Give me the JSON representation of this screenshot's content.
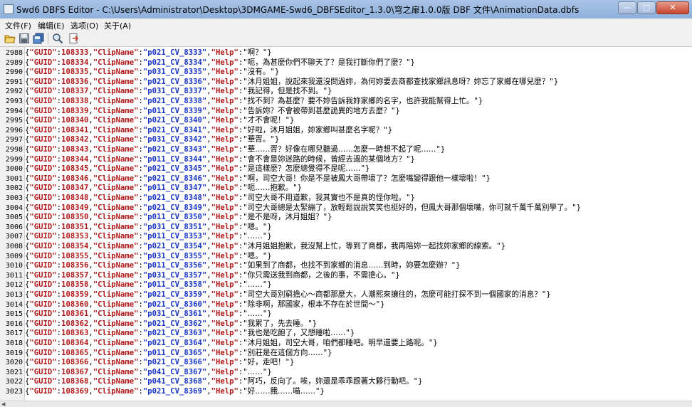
{
  "window": {
    "title": "Swd6 DBFS Editor - C:\\Users\\Administrator\\Desktop\\3DMGAME-Swd6_DBFSEditor_1.3.0\\穹之扉1.0.0版 DBF 文件\\AnimationData.dbfs",
    "min_label": "—",
    "max_label": "□",
    "close_label": "✕"
  },
  "menu": [
    {
      "label": "文件(F)"
    },
    {
      "label": "编辑(E)"
    },
    {
      "label": "选项(O)"
    },
    {
      "label": "关于(A)"
    }
  ],
  "toolbar_icons": [
    "open-folder-icon",
    "save-icon",
    "save-all-icon",
    "search-icon",
    "export-icon"
  ],
  "colors": {
    "key": "#b11a1a",
    "string_value": "#1a37c5",
    "number_value": "#b11a1a"
  },
  "rows": [
    {
      "n": "2988",
      "guid": "108333",
      "clip": "p021_CV_8333",
      "help": "啊？"
    },
    {
      "n": "2989",
      "guid": "108334",
      "clip": "p021_CV_8334",
      "help": "呃，為甚麼你們不聊天了？是我打斷你們了麼？"
    },
    {
      "n": "2990",
      "guid": "108335",
      "clip": "p031_CV_8335",
      "help": "沒有。"
    },
    {
      "n": "2991",
      "guid": "108336",
      "clip": "p021_CV_8336",
      "help": "沐月姐姐，說起來我還沒問過妳，為何妳要去商都查找家鄉訊息呀？妳忘了家鄉在哪兒麼？"
    },
    {
      "n": "2992",
      "guid": "108337",
      "clip": "p031_CV_8337",
      "help": "我記得，但是找不到。"
    },
    {
      "n": "2993",
      "guid": "108338",
      "clip": "p021_CV_8338",
      "help": "找不到？為甚麼？要不妳告訴我妳家鄉的名字，也許我能幫得上忙。"
    },
    {
      "n": "2994",
      "guid": "108339",
      "clip": "p011_CV_8339",
      "help": "告訴妳？不會被帶到甚麼詭異的地方去麼？"
    },
    {
      "n": "2995",
      "guid": "108340",
      "clip": "p021_CV_8340",
      "help": "才不會呢！"
    },
    {
      "n": "2996",
      "guid": "108341",
      "clip": "p021_CV_8341",
      "help": "好啦，沐月姐姐，妳家鄉叫甚麼名字呢？"
    },
    {
      "n": "2997",
      "guid": "108342",
      "clip": "p031_CV_8342",
      "help": "華胥。"
    },
    {
      "n": "2998",
      "guid": "108343",
      "clip": "p021_CV_8343",
      "help": "華……胥？好像在哪兒聽過……怎麼一時想不起了呢……"
    },
    {
      "n": "2999",
      "guid": "108344",
      "clip": "p011_CV_8344",
      "help": "會不會是妳迷路的時候，曾經去過的某個地方？"
    },
    {
      "n": "3000",
      "guid": "108345",
      "clip": "p021_CV_8345",
      "help": "是這樣麼？怎麼總覺得不是呢……"
    },
    {
      "n": "3001",
      "guid": "108346",
      "clip": "p021_CV_8346",
      "help": "啊，司空大哥！你是不是被鳳大哥帶壞了？怎麼嘴變得跟他一樣壞啦！"
    },
    {
      "n": "3002",
      "guid": "108347",
      "clip": "p011_CV_8347",
      "help": "呃……抱歉。"
    },
    {
      "n": "3003",
      "guid": "108348",
      "clip": "p021_CV_8348",
      "help": "司空大哥不用道歉，我其實也不是真的怪你啦。"
    },
    {
      "n": "3004",
      "guid": "108349",
      "clip": "p021_CV_8349",
      "help": "司空大哥總是太緊繃了，放輕鬆說說笑笑也挺好的，但鳳大哥那個壞嘴，你可就千萬千萬別學了。"
    },
    {
      "n": "3005",
      "guid": "108350",
      "clip": "p011_CV_8350",
      "help": "是不是呀，沐月姐姐？"
    },
    {
      "n": "3006",
      "guid": "108351",
      "clip": "p031_CV_8351",
      "help": "嗯。"
    },
    {
      "n": "3007",
      "guid": "108353",
      "clip": "p011_CV_8353",
      "help": "……"
    },
    {
      "n": "3008",
      "guid": "108354",
      "clip": "p021_CV_8354",
      "help": "沐月姐姐抱歉，我沒幫上忙，等到了商都，我再陪妳一起找妳家鄉的線索。"
    },
    {
      "n": "3009",
      "guid": "108355",
      "clip": "p031_CV_8355",
      "help": "嗯。"
    },
    {
      "n": "3010",
      "guid": "108356",
      "clip": "p011_CV_8356",
      "help": "如果到了商都，也找不到家鄉的消息……到時，妳要怎麼辦？"
    },
    {
      "n": "3011",
      "guid": "108357",
      "clip": "p031_CV_8357",
      "help": "你只需送我到商都，之後的事，不需擔心。"
    },
    {
      "n": "3012",
      "guid": "108358",
      "clip": "p011_CV_8358",
      "help": "……"
    },
    {
      "n": "3013",
      "guid": "108359",
      "clip": "p021_CV_8359",
      "help": "司空大哥別窮擔心～商都那麼大，人潮熙來攘往的，怎麼可能打探不到一個國家的消息？"
    },
    {
      "n": "3014",
      "guid": "108360",
      "clip": "p021_CV_8360",
      "help": "除非啊，那國家，根本不存在於世間～"
    },
    {
      "n": "3015",
      "guid": "108361",
      "clip": "p031_CV_8361",
      "help": "……"
    },
    {
      "n": "3016",
      "guid": "108362",
      "clip": "p021_CV_8362",
      "help": "我累了，先去睡。"
    },
    {
      "n": "3017",
      "guid": "108363",
      "clip": "p021_CV_8363",
      "help": "我也是吃飽了，又想睡啦……"
    },
    {
      "n": "3018",
      "guid": "108364",
      "clip": "p021_CV_8364",
      "help": "沐月姐姐，司空大哥，咱們都睡吧。明早還要上路呢。"
    },
    {
      "n": "3019",
      "guid": "108365",
      "clip": "p011_CV_8365",
      "help": "別莊是在這個方向……"
    },
    {
      "n": "3020",
      "guid": "108366",
      "clip": "p021_CV_8366",
      "help": "好，走吧！"
    },
    {
      "n": "3021",
      "guid": "108367",
      "clip": "p041_CV_8367",
      "help": "……"
    },
    {
      "n": "3022",
      "guid": "108368",
      "clip": "p041_CV_8368",
      "help": "阿巧，反向了。唉，妳還是乖乖跟著大夥行動吧。"
    },
    {
      "n": "3023",
      "guid": "108369",
      "clip": "p021_CV_8369",
      "help": "好……餓……喵……"
    }
  ]
}
